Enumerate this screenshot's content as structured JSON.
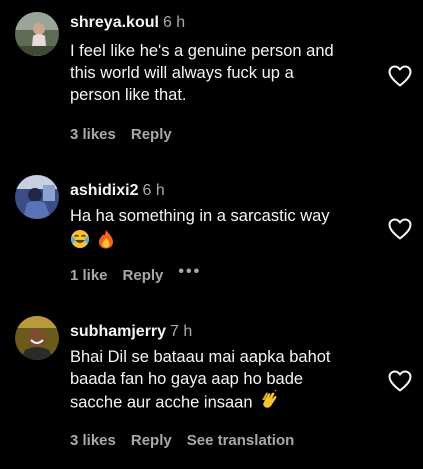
{
  "comments": [
    {
      "username": "shreya.koul",
      "time": "6 h",
      "lines": [
        "I feel like he's a genuine person and",
        "this world will always fuck up a",
        "person like that."
      ],
      "likes": "3 likes",
      "reply": "Reply",
      "avatar_icon": "avatar-photo-girl-outdoor"
    },
    {
      "username": "ashidixi2",
      "time": "6 h",
      "lines": [
        "Ha ha something in a sarcastic way"
      ],
      "emojis": [
        "face-with-tears-of-joy",
        "fire"
      ],
      "likes": "1 like",
      "reply": "Reply",
      "more": "•••",
      "avatar_icon": "avatar-photo-blue"
    },
    {
      "username": "subhamjerry",
      "time": "7 h",
      "lines": [
        "Bhai Dil se bataau mai aapka bahot",
        "baada fan ho gaya aap ho bade",
        "sacche aur acche insaan"
      ],
      "emojis": [
        "clapping-hands"
      ],
      "likes": "3 likes",
      "reply": "Reply",
      "translation": "See translation",
      "avatar_icon": "avatar-photo-man-smiling"
    }
  ],
  "colors": {
    "background": "#000000",
    "primary_text": "#f5f5f5",
    "secondary_text": "#a8a8a8"
  }
}
